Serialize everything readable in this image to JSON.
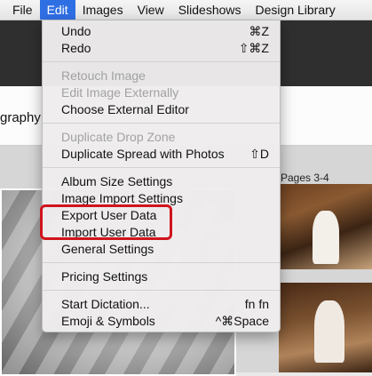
{
  "menubar": {
    "items": [
      "File",
      "Edit",
      "Images",
      "View",
      "Slideshows",
      "Design Library"
    ],
    "active_index": 1,
    "active_color": "#2f6fe4"
  },
  "background": {
    "partial_text": "graphy",
    "pages_label": "Pages 3-4"
  },
  "edit_menu": {
    "undo": {
      "label": "Undo",
      "shortcut": "⌘Z"
    },
    "redo": {
      "label": "Redo",
      "shortcut": "⇧⌘Z"
    },
    "retouch": {
      "label": "Retouch Image"
    },
    "edit_externally": {
      "label": "Edit Image Externally"
    },
    "choose_editor": {
      "label": "Choose External Editor"
    },
    "duplicate_drop_zone": {
      "label": "Duplicate Drop Zone"
    },
    "duplicate_spread": {
      "label": "Duplicate Spread with Photos",
      "shortcut": "⇧D"
    },
    "album_size": {
      "label": "Album Size Settings"
    },
    "image_import": {
      "label": "Image Import Settings"
    },
    "export_user_data": {
      "label": "Export User Data"
    },
    "import_user_data": {
      "label": "Import User Data"
    },
    "general_settings": {
      "label": "General Settings"
    },
    "pricing_settings": {
      "label": "Pricing Settings"
    },
    "start_dictation": {
      "label": "Start Dictation...",
      "shortcut": "fn fn"
    },
    "emoji_symbols": {
      "label": "Emoji & Symbols",
      "shortcut": "^⌘Space"
    }
  },
  "highlight_color": "#d0141c"
}
